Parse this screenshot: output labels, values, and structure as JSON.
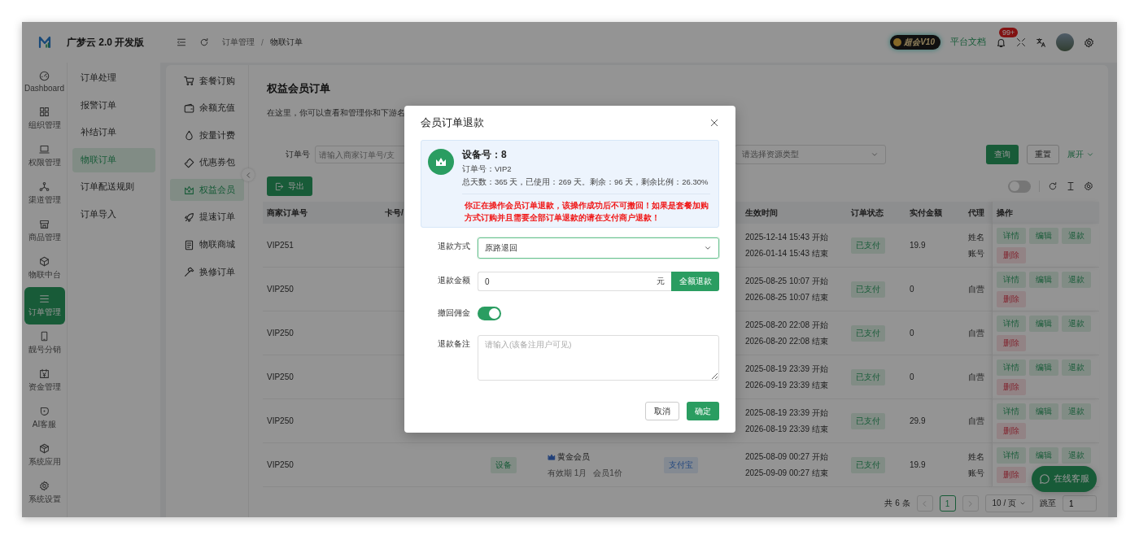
{
  "app": {
    "title": "广梦云 2.0 开发版"
  },
  "header": {
    "breadcrumb": [
      "订单管理",
      "物联订单"
    ],
    "breadcrumb_separator": "/",
    "vip_badge": "超会V10",
    "docs_link": "平台文档",
    "notification_count": "99+"
  },
  "main_nav": [
    {
      "label": "Dashboard",
      "selected": false
    },
    {
      "label": "组织管理",
      "selected": false
    },
    {
      "label": "权限管理",
      "selected": false
    },
    {
      "label": "渠道管理",
      "selected": false
    },
    {
      "label": "商品管理",
      "selected": false
    },
    {
      "label": "物联中台",
      "selected": false
    },
    {
      "label": "订单管理",
      "selected": true
    },
    {
      "label": "靓号分销",
      "selected": false
    },
    {
      "label": "资金管理",
      "selected": false
    },
    {
      "label": "AI客服",
      "selected": false
    },
    {
      "label": "系统应用",
      "selected": false
    },
    {
      "label": "系统设置",
      "selected": false
    }
  ],
  "sub_nav": [
    {
      "label": "订单处理",
      "selected": false
    },
    {
      "label": "报警订单",
      "selected": false
    },
    {
      "label": "补结订单",
      "selected": false
    },
    {
      "label": "物联订单",
      "selected": true
    },
    {
      "label": "订单配送规则",
      "selected": false
    },
    {
      "label": "订单导入",
      "selected": false
    }
  ],
  "third_nav": [
    {
      "label": "套餐订购",
      "selected": false
    },
    {
      "label": "余额充值",
      "selected": false
    },
    {
      "label": "按量计费",
      "selected": false
    },
    {
      "label": "优惠券包",
      "selected": false
    },
    {
      "label": "权益会员",
      "selected": true
    },
    {
      "label": "提速订单",
      "selected": false
    },
    {
      "label": "物联商城",
      "selected": false
    },
    {
      "label": "换修订单",
      "selected": false
    }
  ],
  "page": {
    "title": "权益会员订单",
    "description": "在这里，你可以查看和管理你和下游名"
  },
  "filters": {
    "order_label": "订单号",
    "order_placeholder": "请输入商家订单号/支",
    "source_placeholder": "请选择资源类型",
    "query": "查询",
    "reset": "重置",
    "expand": "展开"
  },
  "toolbar": {
    "export": "导出",
    "switch_on": false
  },
  "table": {
    "columns": [
      "商家订单号",
      "卡号/",
      "生效时间",
      "订单状态",
      "实付金额",
      "代理",
      "操作"
    ],
    "rows": [
      {
        "order_no": "VIP251",
        "validity_start": "2025-12-14 15:43 开始",
        "validity_end": "2026-01-14 15:43 结束",
        "status": "已支付",
        "amount": "19.9",
        "agent": [
          "姓名",
          "账号"
        ],
        "actions": [
          {
            "label": "详情",
            "kind": "normal"
          },
          {
            "label": "编辑",
            "kind": "normal"
          },
          {
            "label": "退款",
            "kind": "normal"
          },
          {
            "label": "删除",
            "kind": "danger"
          }
        ]
      },
      {
        "order_no": "VIP250",
        "validity_start": "2025-08-25 10:07 开始",
        "validity_end": "2026-08-25 10:07 结束",
        "status": "已支付",
        "amount": "0",
        "agent": [
          "自营"
        ],
        "actions": [
          {
            "label": "详情",
            "kind": "normal"
          },
          {
            "label": "编辑",
            "kind": "normal"
          },
          {
            "label": "退款",
            "kind": "normal"
          },
          {
            "label": "删除",
            "kind": "danger"
          }
        ]
      },
      {
        "order_no": "VIP250",
        "validity_start": "2025-08-20 22:08 开始",
        "validity_end": "2026-08-20 22:08 结束",
        "status": "已支付",
        "amount": "0",
        "agent": [
          "自营"
        ],
        "actions": [
          {
            "label": "详情",
            "kind": "normal"
          },
          {
            "label": "编辑",
            "kind": "normal"
          },
          {
            "label": "退款",
            "kind": "normal"
          },
          {
            "label": "删除",
            "kind": "danger"
          }
        ]
      },
      {
        "order_no": "VIP250",
        "validity_start": "2025-08-19 23:39 开始",
        "validity_end": "2026-09-19 23:39 结束",
        "status": "已支付",
        "amount": "0",
        "agent": [
          "自营"
        ],
        "actions": [
          {
            "label": "详情",
            "kind": "normal"
          },
          {
            "label": "编辑",
            "kind": "normal"
          },
          {
            "label": "退款",
            "kind": "normal"
          },
          {
            "label": "删除",
            "kind": "danger"
          }
        ]
      },
      {
        "order_no": "VIP250",
        "validity_start": "2025-08-19 23:39 开始",
        "validity_end": "2026-08-19 23:39 结束",
        "status": "已支付",
        "amount": "29.9",
        "agent": [
          "自营"
        ],
        "actions": [
          {
            "label": "详情",
            "kind": "normal"
          },
          {
            "label": "编辑",
            "kind": "normal"
          },
          {
            "label": "退款",
            "kind": "normal"
          },
          {
            "label": "删除",
            "kind": "danger"
          }
        ]
      },
      {
        "order_no": "VIP250",
        "device_tag": "设备",
        "member": "黄金会员",
        "member_term": "有效期 1月",
        "member_discount": "会员1价",
        "pay_method": "支付宝",
        "validity_start": "2025-08-09 00:27 开始",
        "validity_end": "2025-09-09 00:27 结束",
        "status": "已支付",
        "amount": "19.9",
        "agent": [
          "姓名",
          "账号"
        ],
        "actions": [
          {
            "label": "详情",
            "kind": "normal"
          },
          {
            "label": "编辑",
            "kind": "normal"
          },
          {
            "label": "退款",
            "kind": "normal"
          },
          {
            "label": "删除",
            "kind": "danger"
          }
        ]
      }
    ]
  },
  "pagination": {
    "total": "共 6 条",
    "pages": [
      {
        "label": "1",
        "selected": true
      }
    ],
    "page_size": "10 / 页",
    "jump_label": "跳至",
    "jump_value": "1"
  },
  "chat_button": "在线客服",
  "dialog": {
    "title": "会员订单退款",
    "device_label": "设备号：8",
    "order_label": "订单号：VIP2",
    "stats": "总天数：365 天，已使用：269 天。剩余：96 天，剩余比例：26.30%",
    "warning": "你正在操作会员订单退款，该操作成功后不可撤回！如果是套餐加购方式订购并且需要全部订单退款的请在支付商户退款！",
    "fields": [
      {
        "kind": "select",
        "label": "退款方式",
        "value": "原路退回"
      },
      {
        "kind": "amount",
        "label": "退款金额",
        "value": "0",
        "suffix": "元",
        "button": "全额退款"
      },
      {
        "kind": "switch",
        "label": "撤回佣金",
        "on": true
      },
      {
        "kind": "textarea",
        "label": "退款备注",
        "placeholder": "请输入(该备注用户可见)"
      }
    ],
    "buttons": [
      {
        "label": "取消",
        "kind": "default"
      },
      {
        "label": "确定",
        "kind": "primary"
      }
    ]
  }
}
